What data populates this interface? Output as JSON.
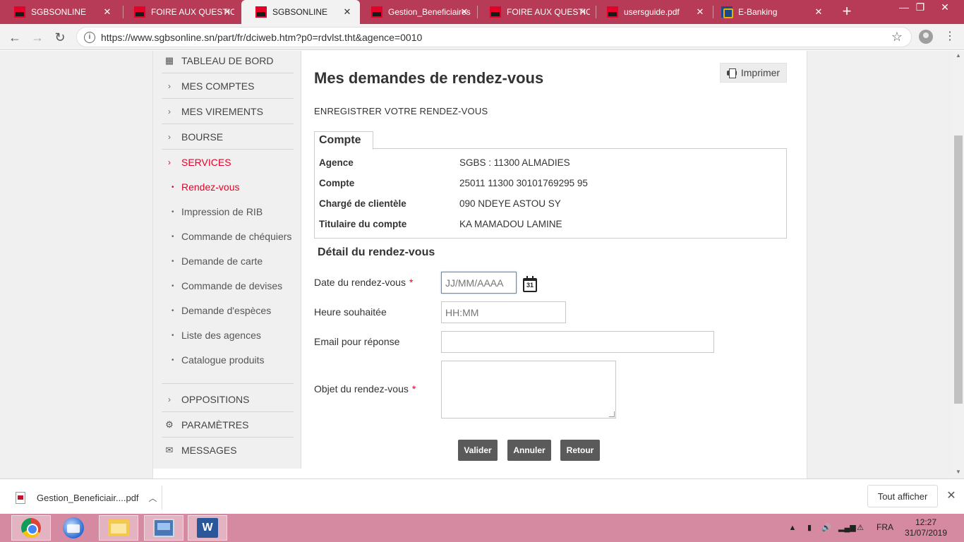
{
  "browser": {
    "tabs": [
      {
        "label": "SGBSONLINE",
        "favicon": "sg-icon",
        "active": false
      },
      {
        "label": "FOIRE AUX QUESTIONS",
        "favicon": "sg-icon",
        "active": false
      },
      {
        "label": "SGBSONLINE",
        "favicon": "sg-icon",
        "active": true
      },
      {
        "label": "Gestion_Beneficiaires",
        "favicon": "sg-icon",
        "active": false
      },
      {
        "label": "FOIRE AUX QUESTIONS",
        "favicon": "sg-icon",
        "active": false
      },
      {
        "label": "usersguide.pdf",
        "favicon": "sg-icon",
        "active": false
      },
      {
        "label": "E-Banking",
        "favicon": "ebanking-icon",
        "active": false
      }
    ],
    "new_tab_symbol": "+",
    "url": "https://www.sgbsonline.sn/part/fr/dciweb.htm?p0=rdvlst.tht&agence=0010"
  },
  "sidebar": {
    "items": [
      {
        "label": "TABLEAU DE BORD",
        "icon": "dashboard-icon"
      },
      {
        "label": "MES COMPTES",
        "icon": "chevron-right-icon"
      },
      {
        "label": "MES VIREMENTS",
        "icon": "chevron-right-icon"
      },
      {
        "label": "BOURSE",
        "icon": "chevron-right-icon"
      },
      {
        "label": "SERVICES",
        "icon": "chevron-right-icon",
        "active": true
      }
    ],
    "sub_items": [
      {
        "label": "Rendez-vous",
        "active": true
      },
      {
        "label": "Impression de RIB"
      },
      {
        "label": "Commande de chéquiers"
      },
      {
        "label": "Demande de carte"
      },
      {
        "label": "Commande de devises"
      },
      {
        "label": "Demande d'espèces"
      },
      {
        "label": "Liste des agences"
      },
      {
        "label": "Catalogue produits"
      }
    ],
    "bottom_items": [
      {
        "label": "OPPOSITIONS",
        "icon": "chevron-right-icon"
      },
      {
        "label": "PARAMÈTRES",
        "icon": "gear-icon"
      },
      {
        "label": "MESSAGES",
        "icon": "envelope-icon"
      }
    ]
  },
  "main": {
    "title": "Mes demandes de rendez-vous",
    "print_label": "Imprimer",
    "subtitle": "ENREGISTRER VOTRE RENDEZ-VOUS",
    "account_section": {
      "legend": "Compte",
      "rows": [
        {
          "key": "Agence",
          "value": "SGBS : 11300 ALMADIES"
        },
        {
          "key": "Compte",
          "value": "25011 11300 30101769295 95"
        },
        {
          "key": "Chargé de clientèle",
          "value": "090 NDEYE ASTOU SY"
        },
        {
          "key": "Titulaire du compte",
          "value": "KA MAMADOU LAMINE"
        }
      ]
    },
    "detail_title": "Détail du rendez-vous",
    "form": {
      "date_label": "Date du rendez-vous",
      "date_placeholder": "JJ/MM/AAAA",
      "date_value": "",
      "calendar_day": "31",
      "time_label": "Heure souhaitée",
      "time_placeholder": "HH:MM",
      "time_value": "",
      "email_label": "Email pour réponse",
      "email_value": "",
      "object_label": "Objet du rendez-vous",
      "object_value": "",
      "required_mark": "*"
    },
    "buttons": {
      "validate": "Valider",
      "cancel": "Annuler",
      "back": "Retour"
    }
  },
  "downloads": {
    "file": "Gestion_Beneficiair....pdf",
    "show_all": "Tout afficher"
  },
  "taskbar": {
    "language": "FRA",
    "time": "12:27",
    "date": "31/07/2019"
  },
  "colors": {
    "brand_red": "#e60028",
    "tab_strip": "#b73a56",
    "taskbar": "#d58aa1",
    "button_gray": "#5a5a5a"
  }
}
